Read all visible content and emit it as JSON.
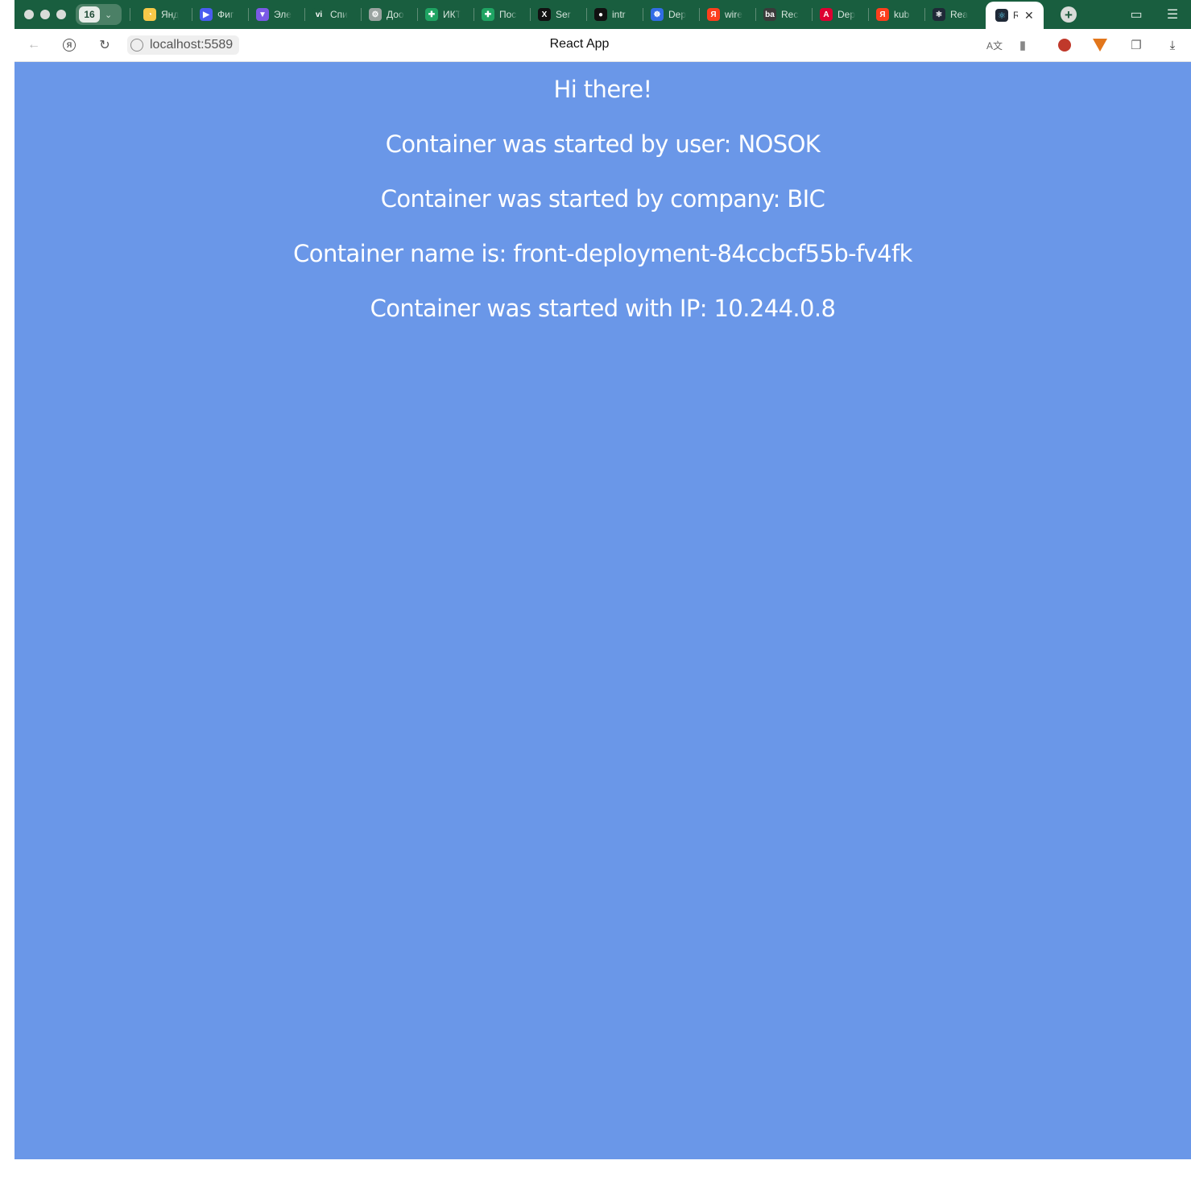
{
  "browser": {
    "tab_count": "16",
    "tabs": [
      {
        "label": "Янд",
        "icon": "yandex-icon",
        "color": "#f7c948"
      },
      {
        "label": "Фиг",
        "icon": "figma-icon",
        "color": "#4a5cf0"
      },
      {
        "label": "Эле",
        "icon": "shield-icon",
        "color": "#7a5ae6"
      },
      {
        "label": "Спи",
        "icon": "vi-icon",
        "color": "#195e3f"
      },
      {
        "label": "Доо",
        "icon": "gear-icon",
        "color": "#9aa3a0"
      },
      {
        "label": "ИКТ",
        "icon": "sheets-icon",
        "color": "#1fa463"
      },
      {
        "label": "Пос",
        "icon": "sheets-icon",
        "color": "#1fa463"
      },
      {
        "label": "Ser",
        "icon": "x-icon",
        "color": "#111111"
      },
      {
        "label": "intr",
        "icon": "github-icon",
        "color": "#111111"
      },
      {
        "label": "Dep",
        "icon": "kubernetes-icon",
        "color": "#326ce5"
      },
      {
        "label": "wire",
        "icon": "yandex-search-icon",
        "color": "#fc3f1d"
      },
      {
        "label": "Rec",
        "icon": "bd-icon",
        "color": "#3a3a3a"
      },
      {
        "label": "Dep",
        "icon": "angular-icon",
        "color": "#dd0031"
      },
      {
        "label": "kub",
        "icon": "yandex-search-icon",
        "color": "#fc3f1d"
      },
      {
        "label": "Rea",
        "icon": "react-icon",
        "color": "#1f2937"
      }
    ],
    "active_tab": {
      "label": "R",
      "icon": "react-icon"
    },
    "url": "localhost:5589",
    "page_title": "React App"
  },
  "content": {
    "greeting": "Hi there!",
    "user_line": "Container was started by user: NOSOK",
    "company_line": "Container was started by company: BIC",
    "name_line": "Container name is: front-deployment-84ccbcf55b-fv4fk",
    "ip_line": "Container was started with IP: 10.244.0.8"
  },
  "colors": {
    "page_background": "#6a97e8",
    "tabbar_background": "#195e3f",
    "text": "#ffffff"
  }
}
